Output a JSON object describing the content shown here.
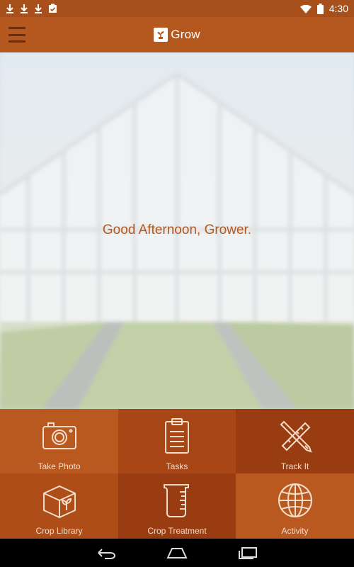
{
  "status_bar": {
    "time": "4:30",
    "notification_icons": [
      "download-icon",
      "download-icon",
      "download-icon",
      "clipboard-icon"
    ]
  },
  "app_bar": {
    "title": "Grow"
  },
  "hero": {
    "greeting": "Good Afternoon, Grower."
  },
  "menu": {
    "items": [
      {
        "label": "Take Photo",
        "icon": "camera-icon"
      },
      {
        "label": "Tasks",
        "icon": "clipboard-icon"
      },
      {
        "label": "Track It",
        "icon": "pencil-ruler-icon"
      },
      {
        "label": "Crop Library",
        "icon": "plant-box-icon"
      },
      {
        "label": "Crop Treatment",
        "icon": "beaker-icon"
      },
      {
        "label": "Activity",
        "icon": "globe-icon"
      }
    ]
  },
  "colors": {
    "primary": "#b5581f",
    "status_bar": "#a8501c",
    "tile_light": "#b9581f",
    "tile_dark": "#9a3c11",
    "greeting_text": "#b5581f"
  }
}
